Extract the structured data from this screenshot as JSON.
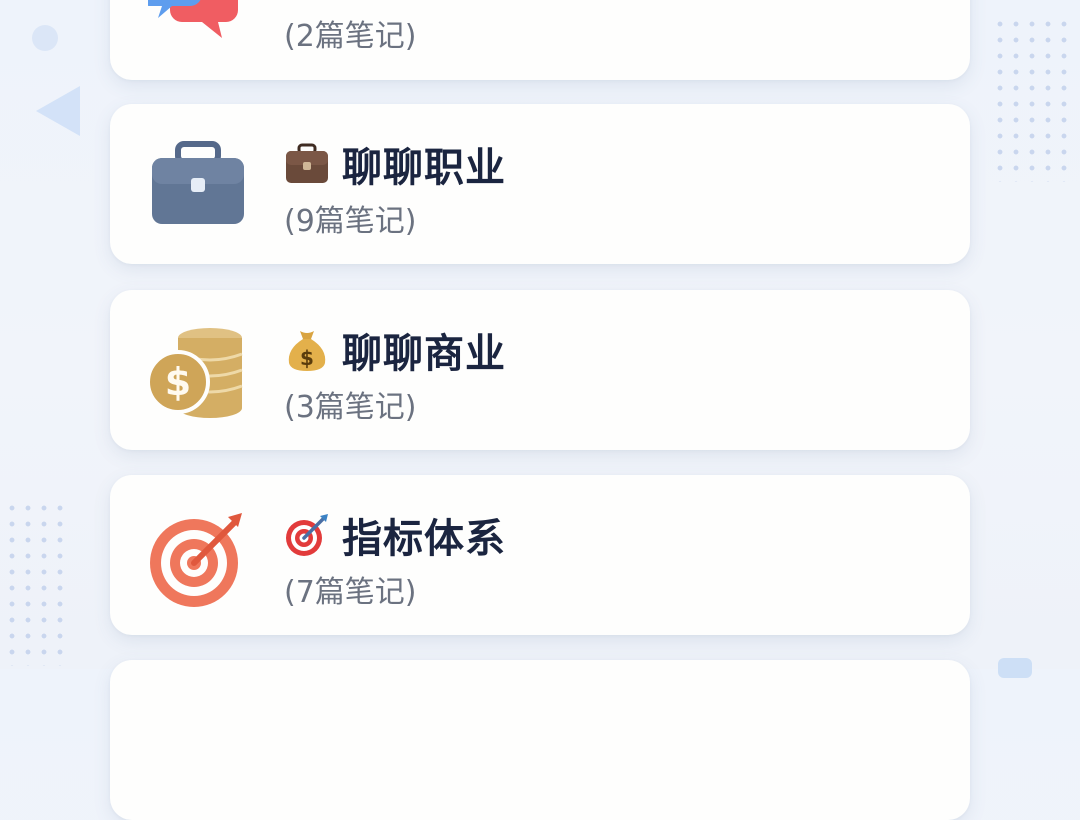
{
  "categories": [
    {
      "icon": "chat-bubbles-icon",
      "title": "",
      "title_emoji": "",
      "count": "(2篇笔记)"
    },
    {
      "icon": "briefcase-icon",
      "title": "聊聊职业",
      "title_emoji": "briefcase-emoji-icon",
      "count": "(9篇笔记)"
    },
    {
      "icon": "coins-dollar-icon",
      "title": "聊聊商业",
      "title_emoji": "money-bag-emoji-icon",
      "count": "(3篇笔记)"
    },
    {
      "icon": "target-icon",
      "title": "指标体系",
      "title_emoji": "direct-hit-emoji-icon",
      "count": "(7篇笔记)"
    }
  ],
  "colors": {
    "background": "#eef3fb",
    "card": "#fefefd",
    "title_text": "#1b2540",
    "count_text": "#6b7280",
    "briefcase": "#617695",
    "coins": "#d1ab5f",
    "target": "#ef775c",
    "chat_blue": "#5e9dee",
    "chat_red": "#f05d62"
  }
}
